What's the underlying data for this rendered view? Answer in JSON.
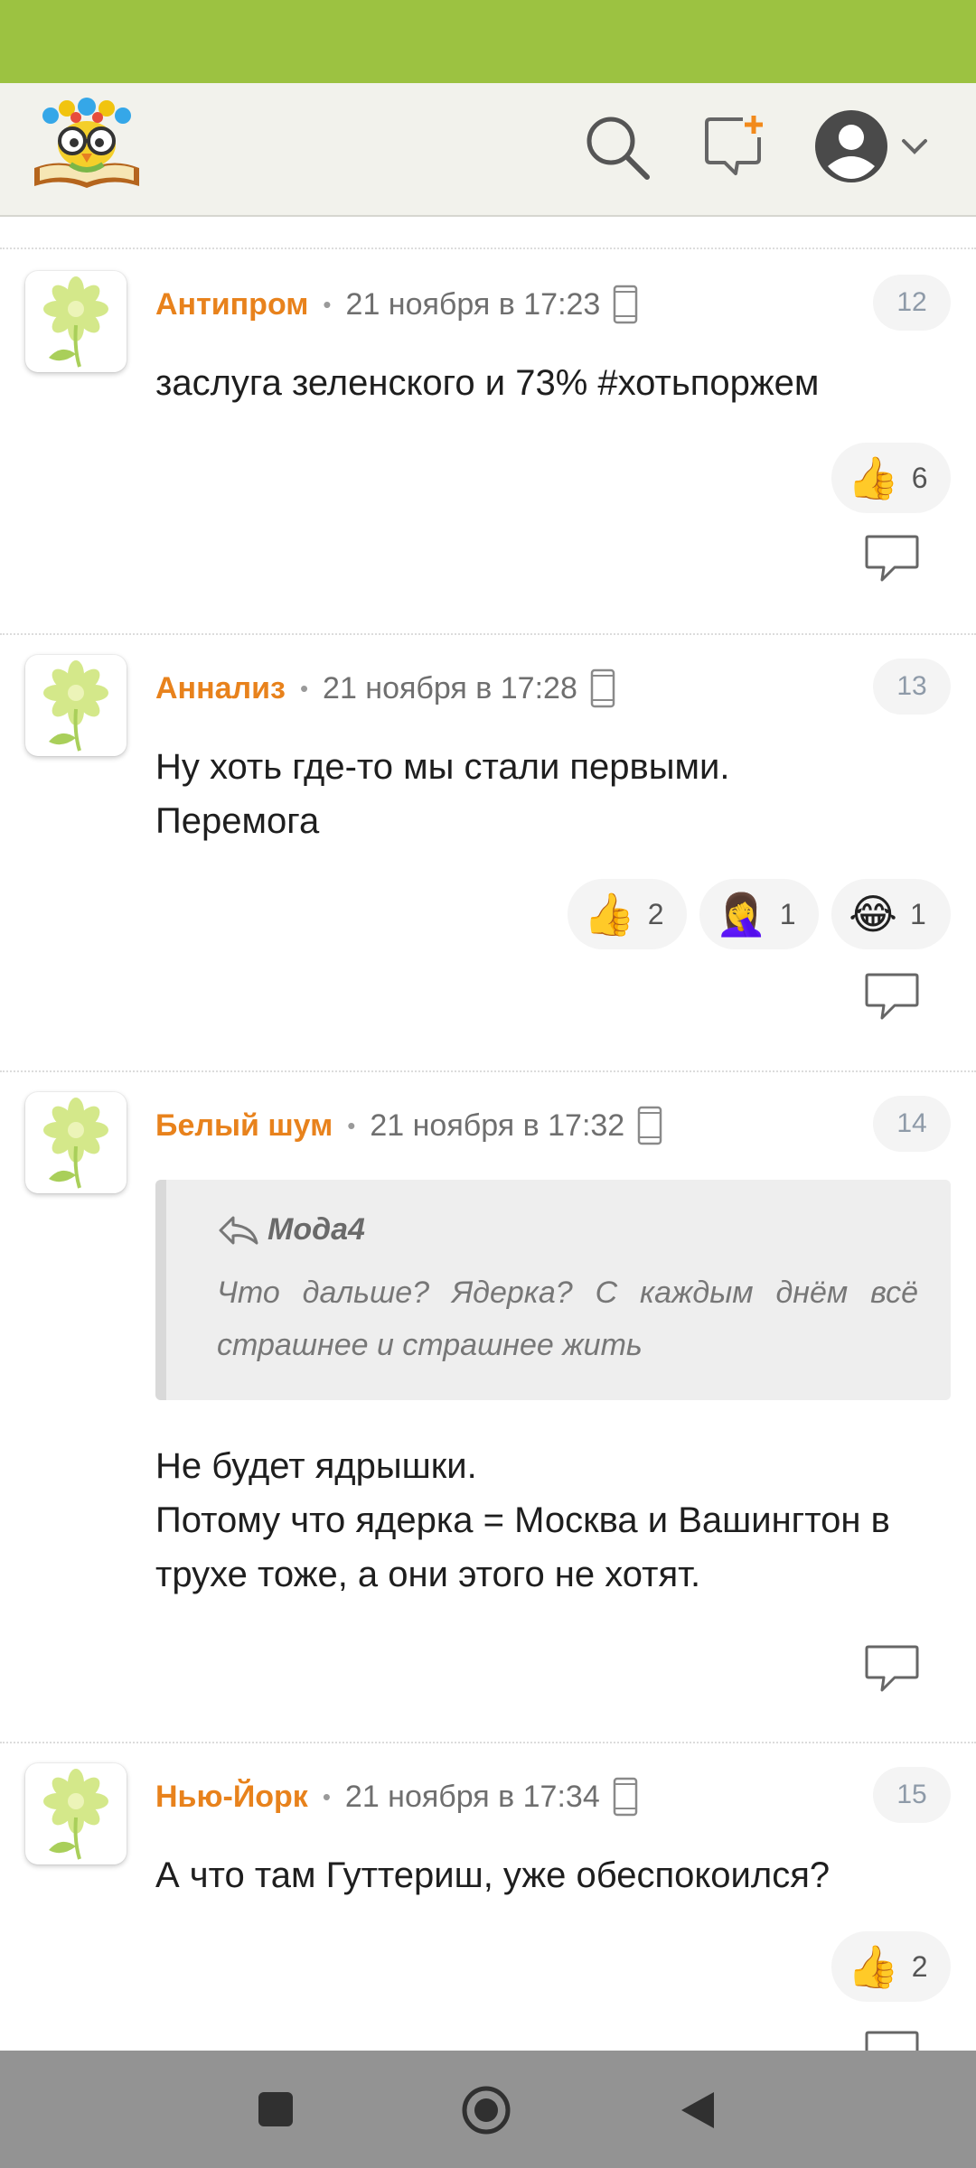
{
  "header": {
    "logo_icon": "owl-on-book-logo",
    "search_icon": "search-icon",
    "new_post_icon": "new-post-icon",
    "profile_icon": "user-avatar-icon",
    "profile_menu_icon": "chevron-down-icon"
  },
  "comments": [
    {
      "author": "Антипром",
      "separator": "•",
      "time": "21 ноября в 17:23",
      "device_icon": "mobile-phone-icon",
      "number": "12",
      "text": "заслуга зеленского и 73% #хотьпоржем",
      "reactions": [
        {
          "emoji": "👍",
          "count": "6"
        }
      ]
    },
    {
      "author": "Анна­лиз",
      "separator": "•",
      "time": "21 ноября в 17:28",
      "device_icon": "mobile-phone-icon",
      "number": "13",
      "text": "Ну хоть где-то мы стали первыми.\nПеремога",
      "reactions": [
        {
          "emoji": "👍",
          "count": "2"
        },
        {
          "emoji": "🤦‍♀️",
          "count": "1"
        },
        {
          "emoji": "😂",
          "count": "1"
        }
      ]
    },
    {
      "author": "Белый шум",
      "separator": "•",
      "time": "21 ноября в 17:32",
      "device_icon": "mobile-phone-icon",
      "number": "14",
      "quote": {
        "author": "Мода4",
        "text": "Что дальше? Ядерка? С каждым днём всё страшнее и страшнее жить"
      },
      "text": "Не будет ядрышки.\nПотому что ядерка = Москва и Вашингтон в трухе тоже, а они этого не хотят.",
      "reactions": []
    },
    {
      "author": "Нью-Йорк",
      "separator": "•",
      "time": "21 ноября в 17:34",
      "device_icon": "mobile-phone-icon",
      "number": "15",
      "text": "А что там Гуттериш, уже обеспокоился?",
      "reactions": [
        {
          "emoji": "👍",
          "count": "2"
        }
      ]
    }
  ],
  "nav": {
    "recents_icon": "square-icon",
    "home_icon": "circle-home-icon",
    "back_icon": "triangle-back-icon"
  },
  "colors": {
    "status_bar": "#9cc241",
    "header_bg": "#f2f2ec",
    "author": "#e8821c",
    "nav_bar": "#939393"
  }
}
